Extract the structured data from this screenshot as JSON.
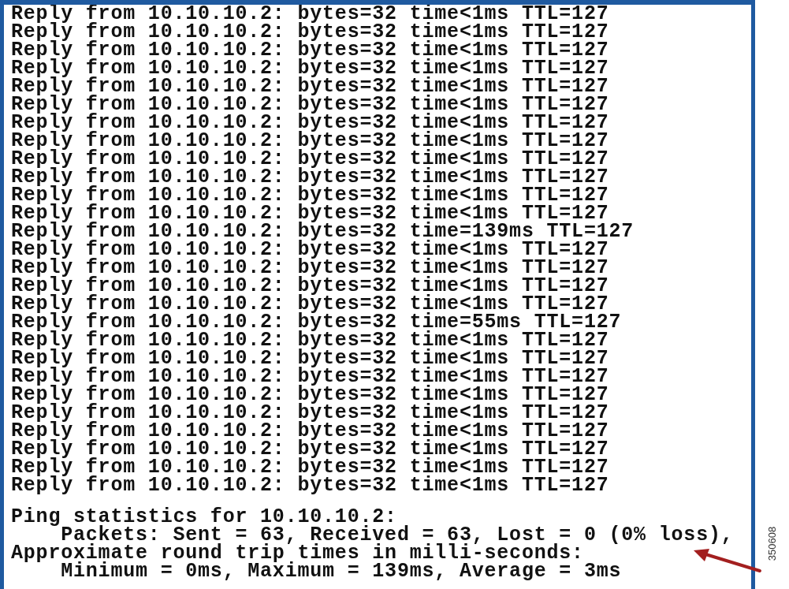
{
  "console": {
    "output_lines": [
      {
        "text": "Reply from 10.10.10.2: bytes=32 time<1ms TTL=127"
      },
      {
        "text": "Reply from 10.10.10.2: bytes=32 time<1ms TTL=127"
      },
      {
        "text": "Reply from 10.10.10.2: bytes=32 time<1ms TTL=127"
      },
      {
        "text": "Reply from 10.10.10.2: bytes=32 time<1ms TTL=127"
      },
      {
        "text": "Reply from 10.10.10.2: bytes=32 time<1ms TTL=127"
      },
      {
        "text": "Reply from 10.10.10.2: bytes=32 time<1ms TTL=127"
      },
      {
        "text": "Reply from 10.10.10.2: bytes=32 time<1ms TTL=127"
      },
      {
        "text": "Reply from 10.10.10.2: bytes=32 time<1ms TTL=127"
      },
      {
        "text": "Reply from 10.10.10.2: bytes=32 time<1ms TTL=127"
      },
      {
        "text": "Reply from 10.10.10.2: bytes=32 time<1ms TTL=127"
      },
      {
        "text": "Reply from 10.10.10.2: bytes=32 time<1ms TTL=127"
      },
      {
        "text": "Reply from 10.10.10.2: bytes=32 time<1ms TTL=127"
      },
      {
        "text": "Reply from 10.10.10.2: bytes=32 time=139ms TTL=127"
      },
      {
        "text": "Reply from 10.10.10.2: bytes=32 time<1ms TTL=127"
      },
      {
        "text": "Reply from 10.10.10.2: bytes=32 time<1ms TTL=127"
      },
      {
        "text": "Reply from 10.10.10.2: bytes=32 time<1ms TTL=127"
      },
      {
        "text": "Reply from 10.10.10.2: bytes=32 time<1ms TTL=127"
      },
      {
        "text": "Reply from 10.10.10.2: bytes=32 time=55ms TTL=127"
      },
      {
        "text": "Reply from 10.10.10.2: bytes=32 time<1ms TTL=127"
      },
      {
        "text": "Reply from 10.10.10.2: bytes=32 time<1ms TTL=127"
      },
      {
        "text": "Reply from 10.10.10.2: bytes=32 time<1ms TTL=127"
      },
      {
        "text": "Reply from 10.10.10.2: bytes=32 time<1ms TTL=127"
      },
      {
        "text": "Reply from 10.10.10.2: bytes=32 time<1ms TTL=127"
      },
      {
        "text": "Reply from 10.10.10.2: bytes=32 time<1ms TTL=127"
      },
      {
        "text": "Reply from 10.10.10.2: bytes=32 time<1ms TTL=127"
      },
      {
        "text": "Reply from 10.10.10.2: bytes=32 time<1ms TTL=127"
      },
      {
        "text": "Reply from 10.10.10.2: bytes=32 time<1ms TTL=127"
      }
    ],
    "statistics_lines": [
      {
        "text": "Ping statistics for 10.10.10.2:"
      },
      {
        "text": "    Packets: Sent = 63, Received = 63, Lost = 0 (0% loss),"
      },
      {
        "text": "Approximate round trip times in milli-seconds:"
      },
      {
        "text": "    Minimum = 0ms, Maximum = 139ms, Average = 3ms"
      }
    ]
  },
  "figure_number": "350608"
}
